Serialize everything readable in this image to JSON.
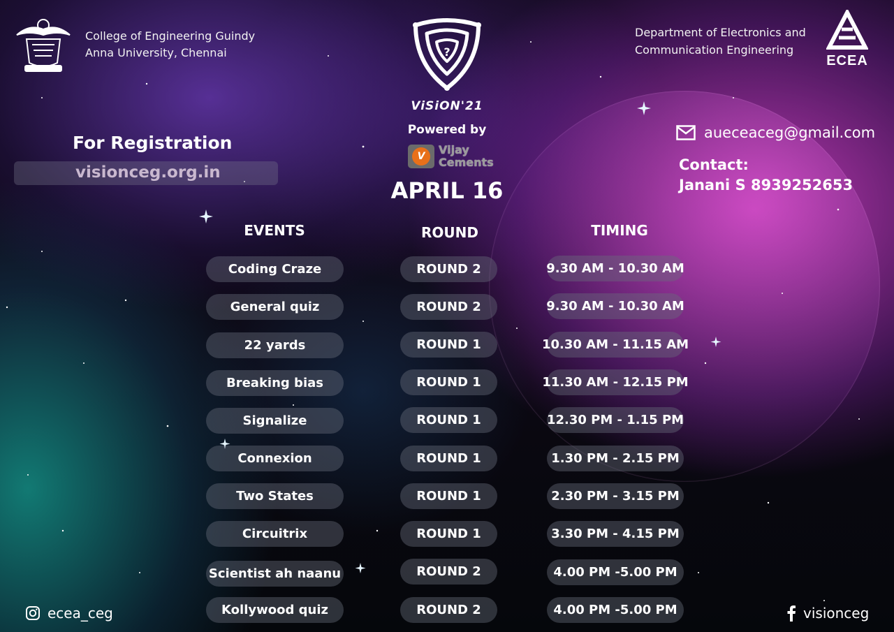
{
  "college": {
    "line1": "College of Engineering Guindy",
    "line2": "Anna University, Chennai",
    "logo_icon": "college-emblem-icon"
  },
  "department": {
    "line1": "Department of Electronics and",
    "line2": "Communication Engineering",
    "logo_text": "ECEA"
  },
  "event": {
    "name": "ViSiON'21",
    "powered_by": "Powered by",
    "sponsor_line1": "Vijay",
    "sponsor_line2": "Cements",
    "sponsor_mark": "V",
    "date": "APRIL 16"
  },
  "registration": {
    "title": "For Registration",
    "url": "visionceg.org.in"
  },
  "contact": {
    "email": "aueceaceg@gmail.com",
    "label": "Contact:",
    "person": "Janani S 8939252653"
  },
  "schedule": {
    "headers": {
      "events": "EVENTS",
      "round": "ROUND",
      "timing": "TIMING"
    },
    "rows": [
      {
        "event": "Coding Craze",
        "round": "ROUND 2",
        "time": "9.30 AM - 10.30 AM"
      },
      {
        "event": "General quiz",
        "round": "ROUND 2",
        "time": "9.30 AM - 10.30 AM"
      },
      {
        "event": "22 yards",
        "round": "ROUND 1",
        "time": "10.30 AM - 11.15 AM"
      },
      {
        "event": "Breaking bias",
        "round": "ROUND 1",
        "time": "11.30 AM - 12.15 PM"
      },
      {
        "event": "Signalize",
        "round": "ROUND 1",
        "time": "12.30 PM - 1.15 PM"
      },
      {
        "event": "Connexion",
        "round": "ROUND 1",
        "time": "1.30 PM - 2.15 PM"
      },
      {
        "event": "Two States",
        "round": "ROUND 1",
        "time": "2.30 PM - 3.15 PM"
      },
      {
        "event": "Circuitrix",
        "round": "ROUND 1",
        "time": "3.30 PM - 4.15 PM"
      },
      {
        "event": "Scientist ah naanu",
        "round": "ROUND 2",
        "time": "4.00 PM -5.00 PM"
      },
      {
        "event": "Kollywood quiz",
        "round": "ROUND 2",
        "time": "4.00 PM -5.00 PM"
      }
    ]
  },
  "social": {
    "instagram": "ecea_ceg",
    "facebook": "visionceg"
  },
  "colors": {
    "pill_bg": "#5f6372",
    "sponsor_orange": "#e8701a",
    "magenta_glow": "#eb46dc",
    "teal_glow": "#1496a0"
  }
}
